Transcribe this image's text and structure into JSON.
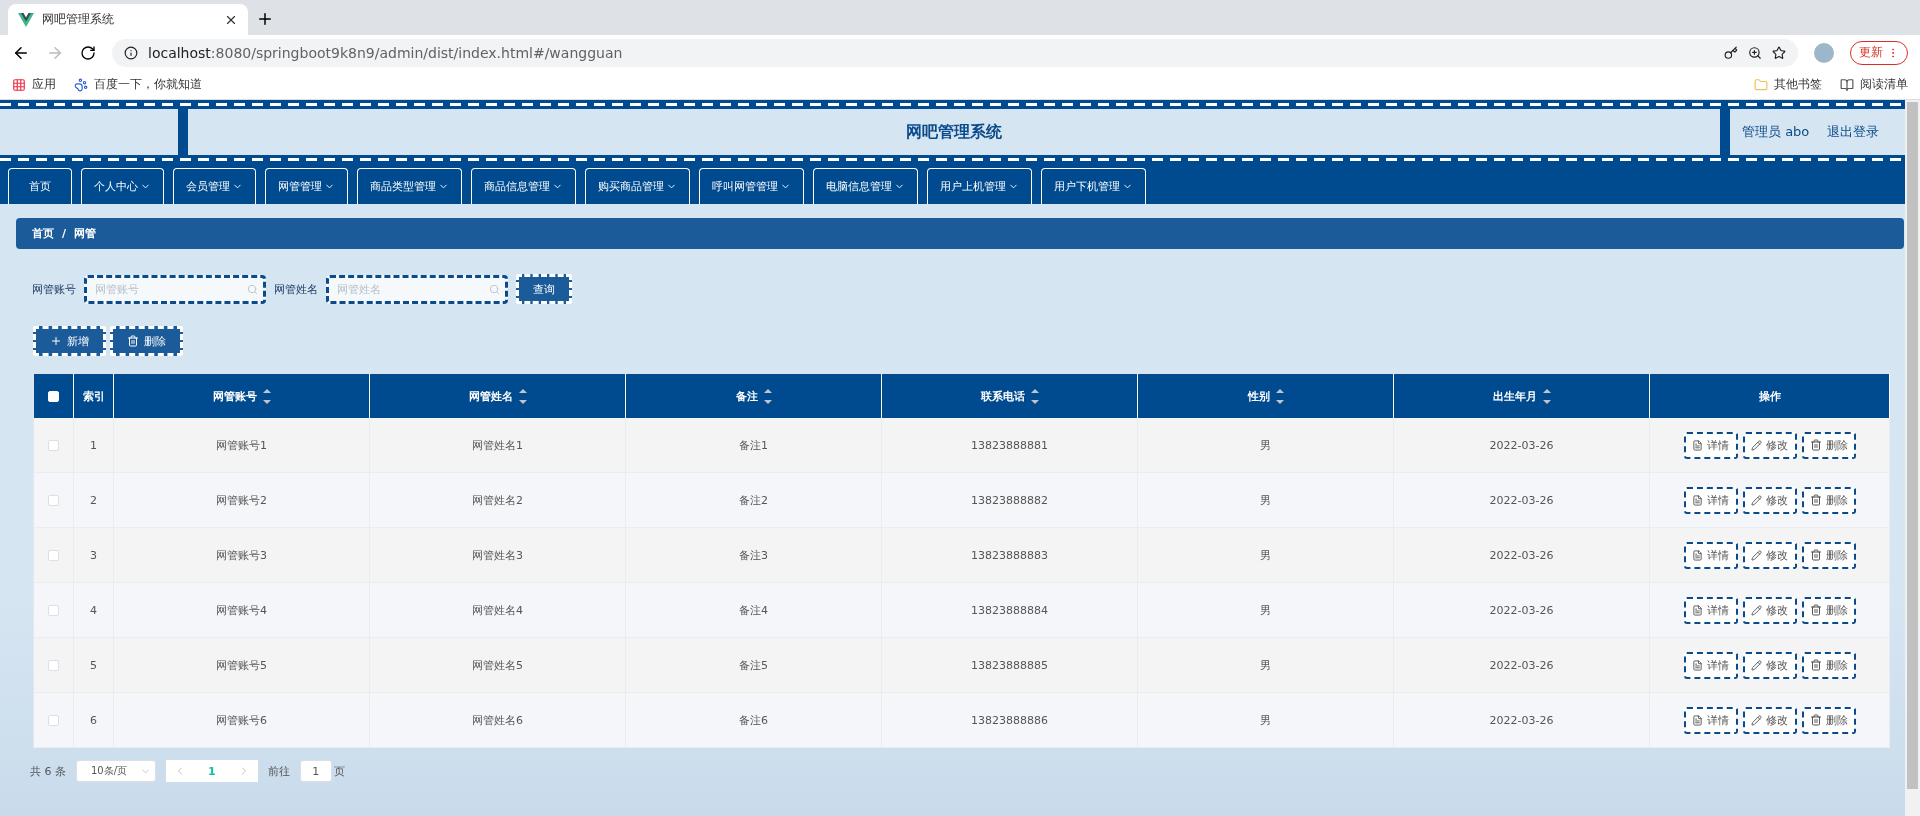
{
  "browser": {
    "tab_title": "网吧管理系统",
    "url_host": "localhost",
    "url_rest": ":8080/springboot9k8n9/admin/dist/index.html#/wangguan",
    "update_button": "更新",
    "bookmarks": [
      {
        "label": "应用",
        "kind": "apps"
      },
      {
        "label": "百度一下，你就知道",
        "kind": "paw"
      }
    ],
    "bookmarks_right": [
      {
        "label": "其他书签",
        "kind": "folder"
      },
      {
        "label": "阅读清单",
        "kind": "list"
      }
    ]
  },
  "header": {
    "title": "网吧管理系统",
    "user": "管理员 abo",
    "logout": "退出登录"
  },
  "nav": [
    {
      "label": "首页",
      "has_menu": false
    },
    {
      "label": "个人中心",
      "has_menu": true
    },
    {
      "label": "会员管理",
      "has_menu": true
    },
    {
      "label": "网管管理",
      "has_menu": true
    },
    {
      "label": "商品类型管理",
      "has_menu": true
    },
    {
      "label": "商品信息管理",
      "has_menu": true
    },
    {
      "label": "购买商品管理",
      "has_menu": true
    },
    {
      "label": "呼叫网管管理",
      "has_menu": true
    },
    {
      "label": "电脑信息管理",
      "has_menu": true
    },
    {
      "label": "用户上机管理",
      "has_menu": true
    },
    {
      "label": "用户下机管理",
      "has_menu": true
    }
  ],
  "breadcrumb": {
    "items": [
      "首页",
      "网管"
    ],
    "separator": "/"
  },
  "search": {
    "fields": [
      {
        "label": "网管账号",
        "placeholder": "网管账号"
      },
      {
        "label": "网管姓名",
        "placeholder": "网管姓名"
      }
    ],
    "button": "查询"
  },
  "actions": [
    {
      "label": "新增",
      "kind": "add"
    },
    {
      "label": "删除",
      "kind": "delete"
    }
  ],
  "table": {
    "header_checked": false,
    "columns": [
      {
        "label": "索引",
        "sortable": false
      },
      {
        "label": "网管账号",
        "sortable": true
      },
      {
        "label": "网管姓名",
        "sortable": true
      },
      {
        "label": "备注",
        "sortable": true
      },
      {
        "label": "联系电话",
        "sortable": true
      },
      {
        "label": "性别",
        "sortable": true
      },
      {
        "label": "出生年月",
        "sortable": true
      },
      {
        "label": "操作",
        "sortable": false
      }
    ],
    "rows": [
      {
        "checked": false,
        "cells": [
          "1",
          "网管账号1",
          "网管姓名1",
          "备注1",
          "13823888881",
          "男",
          "2022-03-26"
        ],
        "actions": [
          {
            "label": "详情",
            "kind": "detail"
          },
          {
            "label": "修改",
            "kind": "edit"
          },
          {
            "label": "删除",
            "kind": "delete"
          }
        ]
      },
      {
        "checked": false,
        "cells": [
          "2",
          "网管账号2",
          "网管姓名2",
          "备注2",
          "13823888882",
          "男",
          "2022-03-26"
        ],
        "actions": [
          {
            "label": "详情",
            "kind": "detail"
          },
          {
            "label": "修改",
            "kind": "edit"
          },
          {
            "label": "删除",
            "kind": "delete"
          }
        ]
      },
      {
        "checked": false,
        "cells": [
          "3",
          "网管账号3",
          "网管姓名3",
          "备注3",
          "13823888883",
          "男",
          "2022-03-26"
        ],
        "actions": [
          {
            "label": "详情",
            "kind": "detail"
          },
          {
            "label": "修改",
            "kind": "edit"
          },
          {
            "label": "删除",
            "kind": "delete"
          }
        ]
      },
      {
        "checked": false,
        "cells": [
          "4",
          "网管账号4",
          "网管姓名4",
          "备注4",
          "13823888884",
          "男",
          "2022-03-26"
        ],
        "actions": [
          {
            "label": "详情",
            "kind": "detail"
          },
          {
            "label": "修改",
            "kind": "edit"
          },
          {
            "label": "删除",
            "kind": "delete"
          }
        ]
      },
      {
        "checked": false,
        "cells": [
          "5",
          "网管账号5",
          "网管姓名5",
          "备注5",
          "13823888885",
          "男",
          "2022-03-26"
        ],
        "actions": [
          {
            "label": "详情",
            "kind": "detail"
          },
          {
            "label": "修改",
            "kind": "edit"
          },
          {
            "label": "删除",
            "kind": "delete"
          }
        ]
      },
      {
        "checked": false,
        "cells": [
          "6",
          "网管账号6",
          "网管姓名6",
          "备注6",
          "13823888886",
          "男",
          "2022-03-26"
        ],
        "actions": [
          {
            "label": "详情",
            "kind": "detail"
          },
          {
            "label": "修改",
            "kind": "edit"
          },
          {
            "label": "删除",
            "kind": "delete"
          }
        ]
      }
    ]
  },
  "pagination": {
    "total": "共 6 条",
    "page_size": "10条/页",
    "pages": [
      {
        "label": "1",
        "selected": true
      }
    ],
    "goto_label": "前往",
    "goto_value": "1",
    "goto_suffix": "页"
  }
}
